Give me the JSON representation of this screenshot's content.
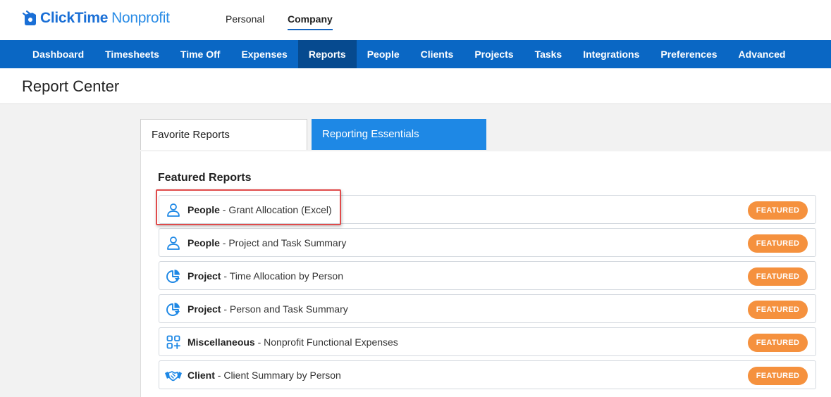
{
  "brand": {
    "name_bold": "ClickTime",
    "name_light": "Nonprofit"
  },
  "scope_tabs": {
    "personal": "Personal",
    "company": "Company"
  },
  "nav": [
    {
      "label": "Dashboard"
    },
    {
      "label": "Timesheets"
    },
    {
      "label": "Time Off"
    },
    {
      "label": "Expenses"
    },
    {
      "label": "Reports",
      "active": true
    },
    {
      "label": "People"
    },
    {
      "label": "Clients"
    },
    {
      "label": "Projects"
    },
    {
      "label": "Tasks"
    },
    {
      "label": "Integrations"
    },
    {
      "label": "Preferences"
    },
    {
      "label": "Advanced"
    }
  ],
  "page": {
    "title": "Report Center"
  },
  "tabs": {
    "favorites": "Favorite Reports",
    "essentials": "Reporting Essentials"
  },
  "featured": {
    "title": "Featured Reports",
    "badge": "FEATURED",
    "items": [
      {
        "category": "People",
        "name": "- Grant Allocation (Excel)",
        "icon": "person-icon"
      },
      {
        "category": "People",
        "name": "- Project and Task Summary",
        "icon": "person-icon"
      },
      {
        "category": "Project",
        "name": "- Time Allocation by Person",
        "icon": "pie-chart-icon"
      },
      {
        "category": "Project",
        "name": "- Person and Task Summary",
        "icon": "pie-chart-icon"
      },
      {
        "category": "Miscellaneous",
        "name": "- Nonprofit Functional Expenses",
        "icon": "apps-add-icon"
      },
      {
        "category": "Client",
        "name": "- Client Summary by Person",
        "icon": "handshake-icon"
      }
    ]
  },
  "colors": {
    "brand_blue": "#1a6fd6",
    "nav_bg": "#0a67c4",
    "nav_active": "#064a8f",
    "tab_active": "#1e88e5",
    "badge": "#f5913e",
    "highlight": "#e04b4b",
    "icon_blue": "#1e88e5"
  }
}
